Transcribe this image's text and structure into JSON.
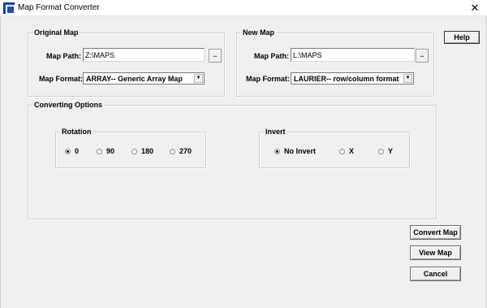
{
  "window": {
    "title": "Map Format Converter",
    "close_glyph": "✕"
  },
  "original_map": {
    "group_label": "Original Map",
    "path_label": "Map Path:",
    "path_value": "Z:\\MAPS",
    "browse_label": "..",
    "format_label": "Map Format:",
    "format_value": "ARRAY-- Generic Array Map"
  },
  "new_map": {
    "group_label": "New Map",
    "path_label": "Map Path:",
    "path_value": "L:\\MAPS",
    "browse_label": "..",
    "format_label": "Map Format:",
    "format_value": "LAURIER-- row/column format"
  },
  "converting_options": {
    "group_label": "Converting Options",
    "rotation": {
      "group_label": "Rotation",
      "options": [
        "0",
        "90",
        "180",
        "270"
      ],
      "selected": "0"
    },
    "invert": {
      "group_label": "Invert",
      "options": [
        "No Invert",
        "X",
        "Y"
      ],
      "selected": "No Invert"
    }
  },
  "buttons": {
    "help": "Help",
    "convert_map": "Convert Map",
    "view_map": "View Map",
    "cancel": "Cancel"
  },
  "icons": {
    "app": "app-icon",
    "dropdown": "chevron-down-icon",
    "close": "close-icon"
  }
}
